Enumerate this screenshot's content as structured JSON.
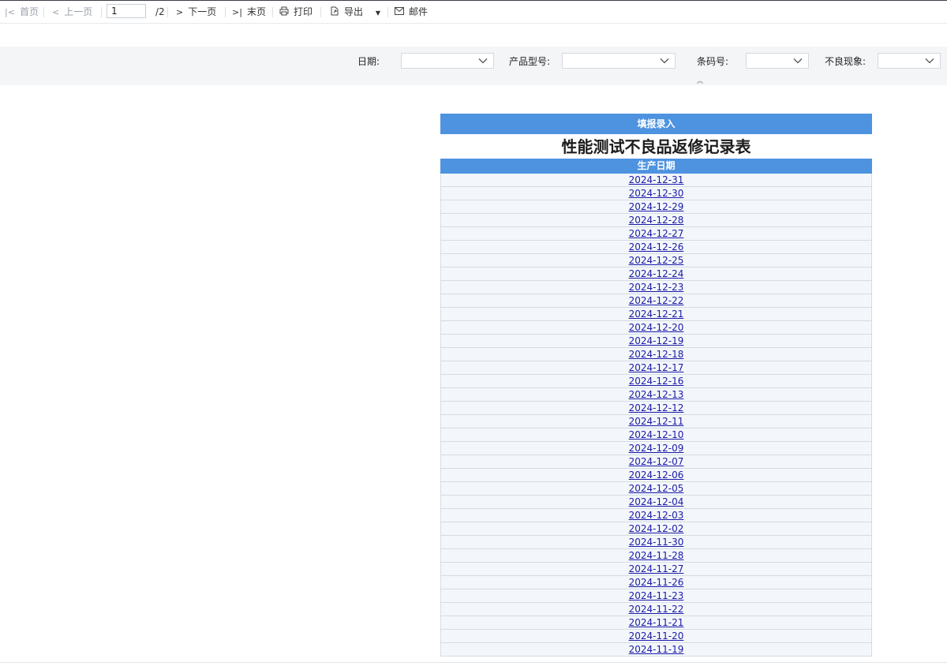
{
  "toolbar": {
    "first_page": "首页",
    "prev_page": "上一页",
    "page_value": "1",
    "page_total": "/2",
    "next_page": "下一页",
    "last_page": "末页",
    "print": "打印",
    "export": "导出",
    "mail": "邮件"
  },
  "filters": {
    "date_label": "日期:",
    "model_label": "产品型号:",
    "barcode_label": "条码号:",
    "defect_label": "不良现象:"
  },
  "report": {
    "entry_button": "填报录入",
    "title": "性能测试不良品返修记录表",
    "column_header": "生产日期",
    "dates": [
      "2024-12-31",
      "2024-12-30",
      "2024-12-29",
      "2024-12-28",
      "2024-12-27",
      "2024-12-26",
      "2024-12-25",
      "2024-12-24",
      "2024-12-23",
      "2024-12-22",
      "2024-12-21",
      "2024-12-20",
      "2024-12-19",
      "2024-12-18",
      "2024-12-17",
      "2024-12-16",
      "2024-12-13",
      "2024-12-12",
      "2024-12-11",
      "2024-12-10",
      "2024-12-09",
      "2024-12-07",
      "2024-12-06",
      "2024-12-05",
      "2024-12-04",
      "2024-12-03",
      "2024-12-02",
      "2024-11-30",
      "2024-11-28",
      "2024-11-27",
      "2024-11-26",
      "2024-11-23",
      "2024-11-22",
      "2024-11-21",
      "2024-11-20",
      "2024-11-19"
    ]
  },
  "icons": {
    "first": "first-page-icon",
    "prev": "prev-page-icon",
    "next": "next-page-icon",
    "last": "last-page-icon",
    "print": "printer-icon",
    "export": "export-icon",
    "mail": "mail-icon"
  },
  "colors": {
    "header_blue": "#4e93e0",
    "row_bg": "#f3f7fb",
    "link": "#1a1aa6"
  }
}
